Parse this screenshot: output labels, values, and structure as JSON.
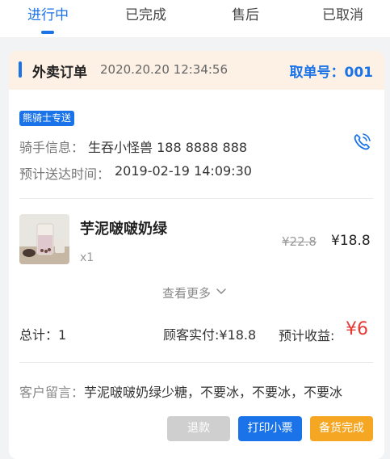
{
  "tabs": [
    {
      "label": "进行中",
      "active": true
    },
    {
      "label": "已完成",
      "active": false
    },
    {
      "label": "售后",
      "active": false
    },
    {
      "label": "已取消",
      "active": false
    }
  ],
  "order": {
    "type_label": "外卖订单",
    "time": "2020.20.20 12:34:56",
    "pickup_number": "取单号：001",
    "delivery_badge": "熊骑士专送",
    "rider_label": "骑手信息：",
    "rider_value": "生吞小怪兽  188 8888 888",
    "eta_label": "预计送达时间：",
    "eta_value": "2019-02-19 14:09:30"
  },
  "item": {
    "name": "芋泥啵啵奶绿",
    "quantity": "x1",
    "original_price": "¥22.8",
    "price": "¥18.8"
  },
  "show_more": "查看更多",
  "summary": {
    "total": "总计：1",
    "paid": "顾客实付:¥18.8",
    "income_label": "预计收益:",
    "income_value": "¥6"
  },
  "note": {
    "label": "客户留言：",
    "text": "芋泥啵啵奶绿少糖，不要冰，不要冰，不要冰"
  },
  "buttons": {
    "refund": "退款",
    "print": "打印小票",
    "prepare": "备货完成"
  },
  "colors": {
    "accent": "#1a73e8",
    "header_bg": "#fdf1e5",
    "income": "#e53935",
    "prepare": "#f5a623",
    "disabled": "#cfcfcf"
  }
}
